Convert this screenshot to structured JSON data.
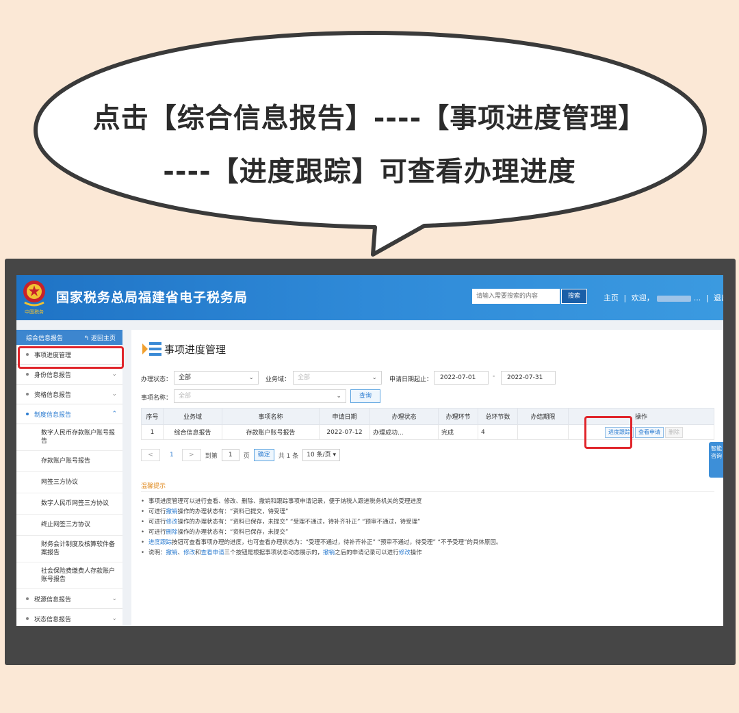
{
  "bubble": {
    "line1": "点击【综合信息报告】----【事项进度管理】",
    "line2": "----【进度跟踪】可查看办理进度"
  },
  "header": {
    "site_title": "国家税务总局福建省电子税务局",
    "search_placeholder": "请输入需要搜索的内容",
    "search_button": "搜索",
    "home_link": "主页",
    "welcome": "欢迎，",
    "welcome_tail": "...",
    "logout": "退出"
  },
  "sidebar": {
    "title": "综合信息报告",
    "back": "返回主页",
    "items": [
      {
        "label": "事项进度管理"
      },
      {
        "label": "身份信息报告"
      },
      {
        "label": "资格信息报告"
      },
      {
        "label": "制度信息报告"
      }
    ],
    "sub_items": [
      "数字人民币存款账户账号报告",
      "存款账户账号报告",
      "网签三方协议",
      "数字人民币网签三方协议",
      "终止网签三方协议",
      "财务会计制度及核算软件备案报告",
      "社会保险费缴费人存款账户账号报告"
    ],
    "bottom_items": [
      {
        "label": "税源信息报告"
      },
      {
        "label": "状态信息报告"
      }
    ]
  },
  "content": {
    "page_title": "事项进度管理",
    "filters": {
      "status_label": "办理状态：",
      "status_value": "全部",
      "domain_label": "业务域：",
      "domain_value": "全部",
      "date_label": "申请日期起止：",
      "date_from": "2022-07-01",
      "date_sep": "-",
      "date_to": "2022-07-31",
      "name_label": "事项名称：",
      "name_value": "全部",
      "query_button": "查询"
    },
    "table": {
      "headers": [
        "序号",
        "业务域",
        "事项名称",
        "申请日期",
        "办理状态",
        "办理环节",
        "总环节数",
        "办结期限",
        "操作"
      ],
      "rows": [
        {
          "no": "1",
          "domain": "综合信息报告",
          "name": "存款账户账号报告",
          "date": "2022-07-12",
          "status": "办理成功...",
          "stage": "完成",
          "total": "4",
          "deadline": "",
          "ops": [
            "进度跟踪",
            "查看申请",
            "删除"
          ]
        }
      ]
    },
    "pager": {
      "prev": "<",
      "current": "1",
      "next": ">",
      "goto": "到第",
      "page_input": "1",
      "page_unit": "页",
      "confirm": "确定",
      "total": "共 1 条",
      "page_size": "10 条/页"
    },
    "tips_title": "温馨提示",
    "tips": [
      {
        "parts": [
          {
            "t": "事项进度管理可以进行查看、修改、删除、撤销和跟踪事项申请记录，便于纳税人跟进税务机关的受理进度",
            "hl": false
          }
        ]
      },
      {
        "parts": [
          {
            "t": "可进行",
            "hl": false
          },
          {
            "t": "撤销",
            "hl": true
          },
          {
            "t": "操作的办理状态有：“资料已提交，待受理”",
            "hl": false
          }
        ]
      },
      {
        "parts": [
          {
            "t": "可进行",
            "hl": false
          },
          {
            "t": "修改",
            "hl": true
          },
          {
            "t": "操作的办理状态有：“资料已保存，未提交”  “受理不通过，待补齐补正”  “预审不通过，待受理”",
            "hl": false
          }
        ]
      },
      {
        "parts": [
          {
            "t": "可进行",
            "hl": false
          },
          {
            "t": "删除",
            "hl": true
          },
          {
            "t": "操作的办理状态有：“资料已保存，未提交”",
            "hl": false
          }
        ]
      },
      {
        "parts": [
          {
            "t": "进度跟踪",
            "hl": true
          },
          {
            "t": "按钮可查看事项办理的进度，也可查看办理状态为：“受理不通过，待补齐补正”  “预审不通过，待受理”  “不予受理”的具体原因。",
            "hl": false
          }
        ]
      },
      {
        "parts": [
          {
            "t": "说明：",
            "hl": false
          },
          {
            "t": "撤销",
            "hl": true
          },
          {
            "t": "、",
            "hl": false
          },
          {
            "t": "修改",
            "hl": true
          },
          {
            "t": "和",
            "hl": false
          },
          {
            "t": "查看申请",
            "hl": true
          },
          {
            "t": "三个按钮是根据事项状态动态展示的，",
            "hl": false
          },
          {
            "t": "撤销",
            "hl": true
          },
          {
            "t": "之后的申请记录可以进行",
            "hl": false
          },
          {
            "t": "修改",
            "hl": true
          },
          {
            "t": "操作",
            "hl": false
          }
        ]
      }
    ],
    "side_tab": "智能咨询"
  },
  "colors": {
    "background": "#fbe8d6",
    "header_blue": "#2f8ad8",
    "highlight_red": "#e0252b",
    "link_blue": "#2f7ed1",
    "tips_orange": "#e08a1e"
  }
}
